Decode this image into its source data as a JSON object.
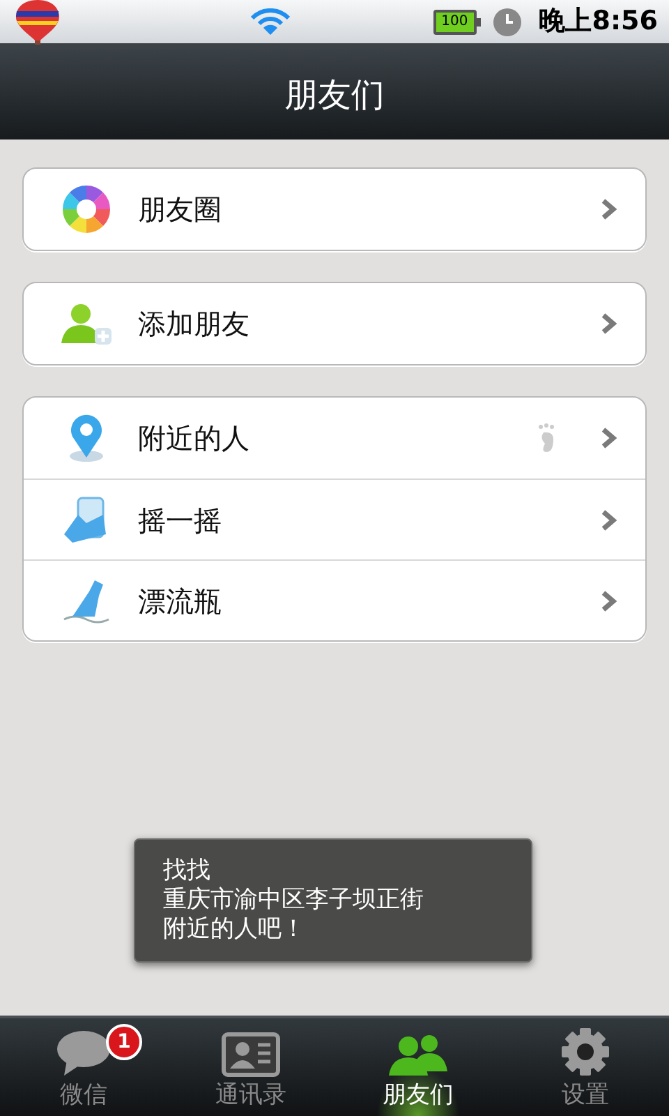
{
  "status_bar": {
    "battery": "100",
    "time": "晚上8:56"
  },
  "title": "朋友们",
  "groups": [
    {
      "items": [
        {
          "kind": "moments",
          "label": "朋友圈",
          "footprint": false
        }
      ]
    },
    {
      "items": [
        {
          "kind": "add",
          "label": "添加朋友",
          "footprint": false
        }
      ]
    },
    {
      "items": [
        {
          "kind": "nearby",
          "label": "附近的人",
          "footprint": true
        },
        {
          "kind": "shake",
          "label": "摇一摇",
          "footprint": false
        },
        {
          "kind": "bottle",
          "label": "漂流瓶",
          "footprint": false
        }
      ]
    }
  ],
  "toast": {
    "lines": [
      "找找",
      "重庆市渝中区李子坝正街",
      "附近的人吧！"
    ]
  },
  "tabs": [
    {
      "kind": "chat",
      "label": "微信",
      "selected": false,
      "badge": "1"
    },
    {
      "kind": "contacts",
      "label": "通讯录",
      "selected": false
    },
    {
      "kind": "friends",
      "label": "朋友们",
      "selected": true
    },
    {
      "kind": "settings",
      "label": "设置",
      "selected": false
    }
  ]
}
